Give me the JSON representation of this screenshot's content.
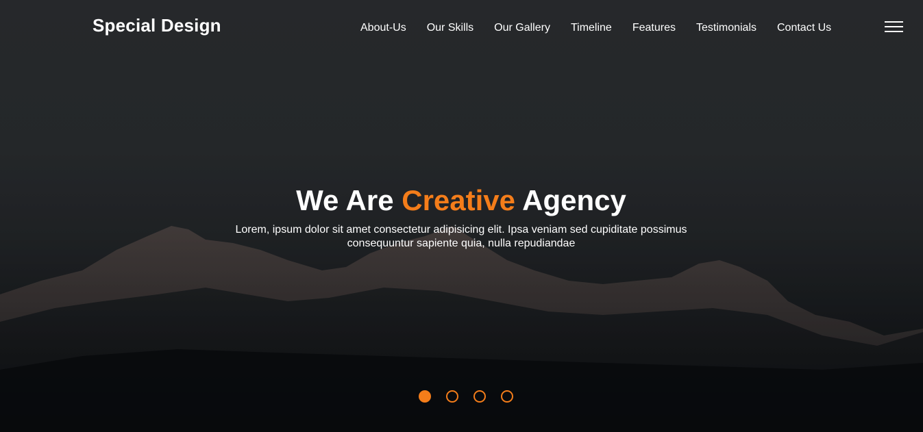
{
  "header": {
    "logo": "Special Design",
    "nav": [
      {
        "label": "About-Us",
        "name": "nav-about-us"
      },
      {
        "label": "Our Skills",
        "name": "nav-our-skills"
      },
      {
        "label": "Our Gallery",
        "name": "nav-our-gallery"
      },
      {
        "label": "Timeline",
        "name": "nav-timeline"
      },
      {
        "label": "Features",
        "name": "nav-features"
      },
      {
        "label": "Testimonials",
        "name": "nav-testimonials"
      },
      {
        "label": "Contact Us",
        "name": "nav-contact-us"
      }
    ],
    "menu_icon": "hamburger-menu-icon"
  },
  "intro": {
    "title_part1": "We Are ",
    "title_accent": "Creative",
    "title_part2": " Agency",
    "paragraph": "Lorem, ipsum dolor sit amet consectetur adipisicing elit. Ipsa veniam sed cupiditate possimus consequuntur sapiente quia, nulla repudiandae"
  },
  "slider": {
    "bullet_count": 4,
    "active_index": 0
  },
  "colors": {
    "accent": "#f47d1a",
    "text": "#ffffff",
    "background": "#2b2e31"
  }
}
